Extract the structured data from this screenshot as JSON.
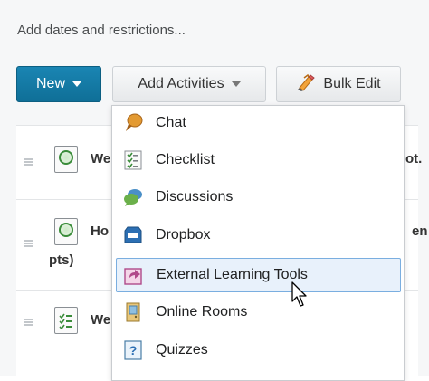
{
  "toolbar": {
    "restrictions_link": "Add dates and restrictions...",
    "new_label": "New",
    "add_activities_label": "Add Activities",
    "bulk_edit_label": "Bulk Edit"
  },
  "rows": [
    {
      "title_prefix": "We",
      "title_suffix": "ot."
    },
    {
      "title_prefix": "Ho",
      "title_suffix": "en",
      "second_line": "pts)"
    },
    {
      "title_prefix": "We"
    }
  ],
  "menu": {
    "items": [
      {
        "label": "Chat",
        "icon": "chat-icon"
      },
      {
        "label": "Checklist",
        "icon": "checklist-icon"
      },
      {
        "label": "Discussions",
        "icon": "discussions-icon"
      },
      {
        "label": "Dropbox",
        "icon": "dropbox-icon"
      },
      {
        "label": "External Learning Tools",
        "icon": "external-tools-icon",
        "highlighted": true
      },
      {
        "label": "Online Rooms",
        "icon": "online-rooms-icon"
      },
      {
        "label": "Quizzes",
        "icon": "quizzes-icon"
      }
    ]
  },
  "colors": {
    "primary_button": "#0f6f97",
    "menu_highlight": "#e8f1fb",
    "menu_highlight_border": "#7aaee0"
  }
}
